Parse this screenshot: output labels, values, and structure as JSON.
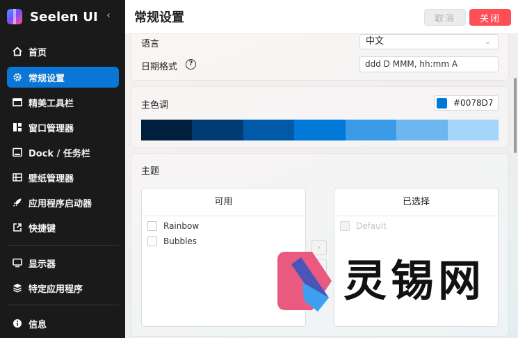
{
  "app": {
    "name": "Seelen UI",
    "collapse_glyph": "‹"
  },
  "sidebar": {
    "items": [
      {
        "label": "首页",
        "icon": "home-icon"
      },
      {
        "label": "常规设置",
        "icon": "gear-icon",
        "active": true
      },
      {
        "label": "精美工具栏",
        "icon": "toolbar-icon"
      },
      {
        "label": "窗口管理器",
        "icon": "window-manager-icon"
      },
      {
        "label": "Dock / 任务栏",
        "icon": "dock-icon"
      },
      {
        "label": "壁纸管理器",
        "icon": "wallpaper-icon"
      },
      {
        "label": "应用程序启动器",
        "icon": "rocket-icon"
      },
      {
        "label": "快捷键",
        "icon": "shortcut-icon"
      },
      {
        "label": "显示器",
        "icon": "monitor-icon"
      },
      {
        "label": "特定应用程序",
        "icon": "layers-icon"
      },
      {
        "label": "信息",
        "icon": "info-icon"
      }
    ]
  },
  "header": {
    "title": "常规设置",
    "cancel_label": "取消",
    "close_label": "关闭"
  },
  "general": {
    "language_label": "语言",
    "language_value": "中文",
    "date_format_label": "日期格式",
    "date_format_value": "ddd D MMM, hh:mm A",
    "help_glyph": "?"
  },
  "accent": {
    "label": "主色调",
    "hex": "#0078D7",
    "palette": [
      "#001f3f",
      "#003d73",
      "#005aa8",
      "#0078d7",
      "#3b9be6",
      "#6db6ef",
      "#a4d5fb"
    ]
  },
  "theme": {
    "label": "主题",
    "available_title": "可用",
    "available": [
      "Rainbow",
      "Bubbles"
    ],
    "selected_title": "已选择",
    "selected": [
      "Default"
    ],
    "move_right_glyph": "›",
    "move_left_glyph": "‹"
  },
  "watermark": {
    "text": "灵锡网"
  }
}
